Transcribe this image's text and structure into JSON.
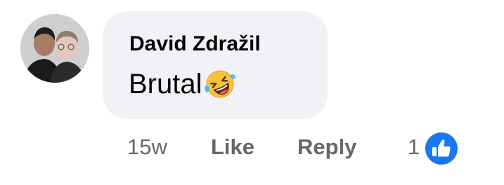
{
  "comment": {
    "author": "David Zdražil",
    "text": "Brutal",
    "emoji": "rolling-on-floor-laughing",
    "timestamp": "15w",
    "like_label": "Like",
    "reply_label": "Reply",
    "reaction_count": "1",
    "reaction_type": "like",
    "colors": {
      "bubble": "#f0f2f5",
      "name": "#050505",
      "meta": "#65676b",
      "like_blue": "#1877f2"
    }
  }
}
